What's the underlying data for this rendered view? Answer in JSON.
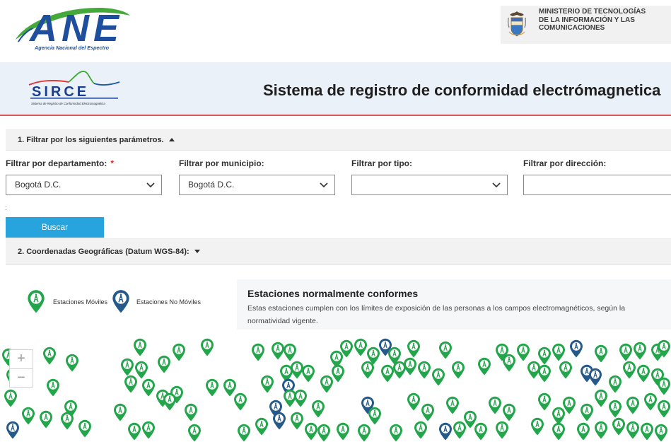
{
  "header": {
    "ane_logo": {
      "wordmark": "ANE",
      "tagline": "Agencia Nacional del Espectro"
    },
    "ministry": {
      "icon": "coat-of-arms-icon",
      "lines": [
        "MINISTERIO DE TECNOLOGÍAS",
        "DE LA INFORMACIÓN Y LAS",
        "COMUNICACIONES"
      ]
    }
  },
  "banner": {
    "sirce_logo": {
      "wordmark": "SIRCE",
      "tagline": "Sistema de Registro de Conformidad Electromagnética"
    },
    "title": "Sistema de registro de conformidad electrómagnetica"
  },
  "filters": {
    "section_title": "1. Filtrar por los siguientes parámetros.",
    "toggle_icon": "caret-up-icon",
    "fields": [
      {
        "label": "Filtrar por departamento:",
        "required_mark": "*",
        "value": "Bogotá D.C."
      },
      {
        "label": "Filtrar por municipio:",
        "value": "Bogotá D.C."
      },
      {
        "label": "Filtrar por tipo:",
        "value": ""
      },
      {
        "label": "Filtrar por dirección:",
        "value": ""
      }
    ],
    "stray_mark": ":",
    "search_button": "Buscar"
  },
  "coordinates": {
    "section_title": "2. Coordenadas Geográficas (Datum WGS-84):",
    "toggle_icon": "caret-down-icon"
  },
  "legend": [
    {
      "label": "Estaciones Móviles",
      "icon": "green-station-pin-icon",
      "color": "#22a54b"
    },
    {
      "label": "Estaciones No Móviles",
      "icon": "blue-station-pin-icon",
      "color": "#24598a"
    }
  ],
  "info": {
    "title": "Estaciones normalmente conformes",
    "text": "Estas estaciones cumplen con los límites de exposición de las personas a los campos electromagnéticos, según la normatividad vigente."
  },
  "map": {
    "zoom_in": "+",
    "zoom_out": "−"
  },
  "colors": {
    "banner_bg": "#eaf1f8",
    "banner_rule": "#e25555",
    "button_bg": "#27a4dd",
    "required_mark": "#e02b2b",
    "ane_blue": "#1e4f9f",
    "ane_green": "#45a83a"
  }
}
